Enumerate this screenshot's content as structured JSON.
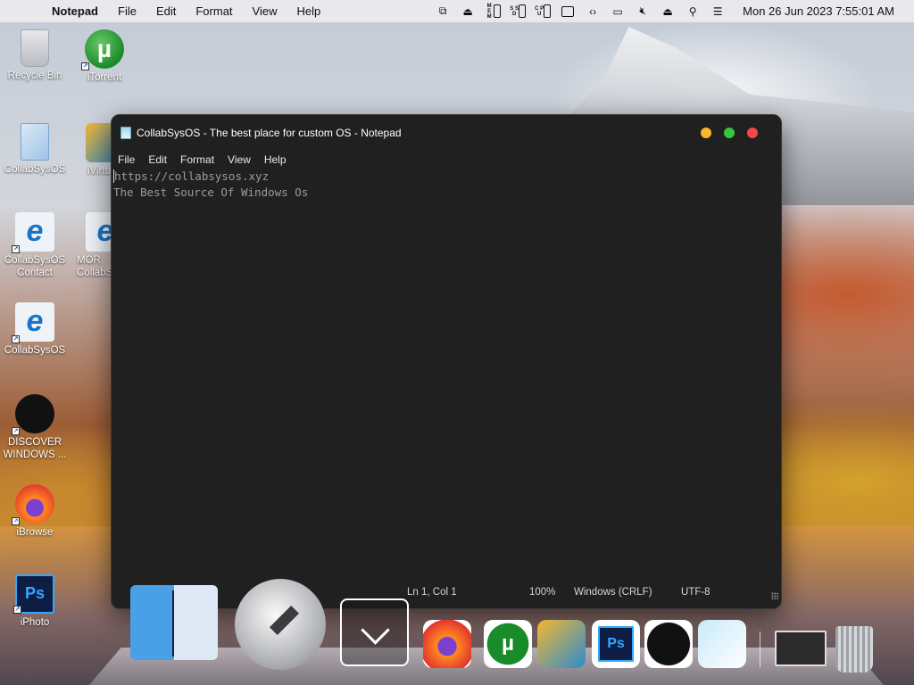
{
  "menubar": {
    "app_name": "Notepad",
    "menus": [
      "File",
      "Edit",
      "Format",
      "View",
      "Help"
    ],
    "tray": [
      {
        "name": "network-icon"
      },
      {
        "name": "download-icon"
      },
      {
        "name": "mem-icon",
        "text": "M E M"
      },
      {
        "name": "ssd-icon",
        "text": "S S D"
      },
      {
        "name": "cpu-icon",
        "text": "C P U"
      },
      {
        "name": "sidebar-icon"
      },
      {
        "name": "code-icon"
      },
      {
        "name": "display-icon"
      },
      {
        "name": "mute-icon"
      },
      {
        "name": "eject-icon"
      },
      {
        "name": "search-icon"
      },
      {
        "name": "control-center-icon"
      }
    ],
    "clock": "Mon 26 Jun 2023 7:55:01 AM"
  },
  "desktop_icons": [
    {
      "label": "Recycle Bin"
    },
    {
      "label": "iTorrent"
    },
    {
      "label": "CollabSysOS"
    },
    {
      "label": "iVirtu"
    },
    {
      "label": "CollabSysOS Contact"
    },
    {
      "label": "MOR CollabS"
    },
    {
      "label": "CollabSysOS"
    },
    {
      "label": "DISCOVER WINDOWS ..."
    },
    {
      "label": "iBrowse"
    },
    {
      "label": "iPhoto"
    }
  ],
  "window": {
    "title": "CollabSysOS - The best place for custom OS - Notepad",
    "menus": [
      "File",
      "Edit",
      "Format",
      "View",
      "Help"
    ],
    "lines": [
      "https://collabsysos.xyz",
      "The Best Source Of Windows Os"
    ],
    "status": {
      "position": "Ln 1, Col 1",
      "zoom": "100%",
      "line_ending": "Windows (CRLF)",
      "encoding": "UTF-8"
    }
  },
  "dock": {
    "items": [
      "finder",
      "launchpad",
      "show-more",
      "firefox",
      "utorrent",
      "virtualbox",
      "photoshop",
      "apple",
      "notepad",
      "window-thumbnail",
      "trash"
    ]
  }
}
